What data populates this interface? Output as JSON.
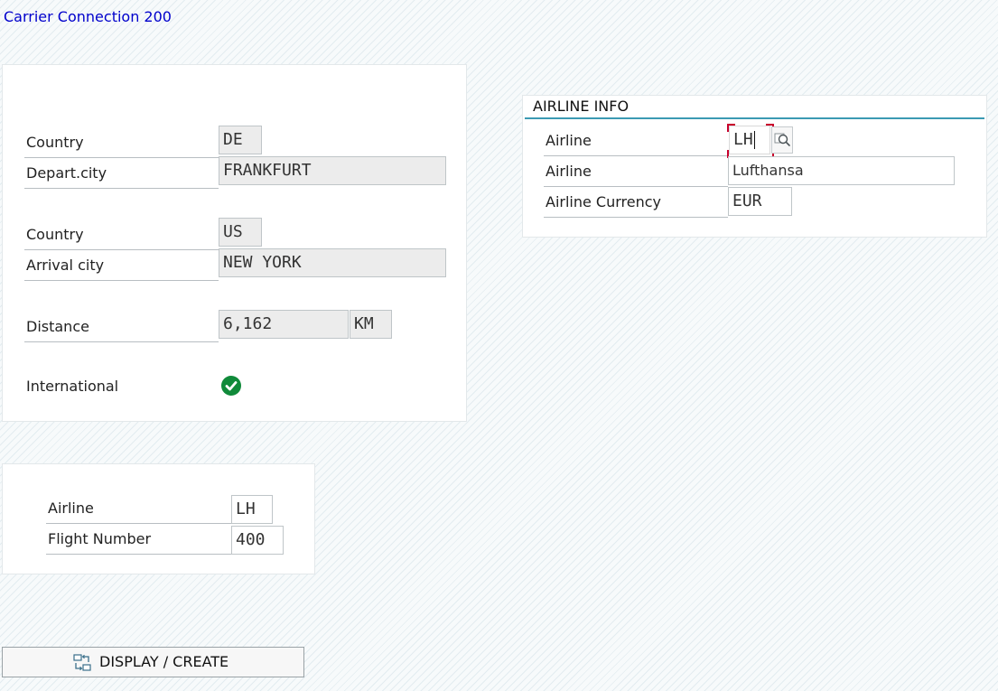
{
  "screen": {
    "title": "Carrier Connection 200"
  },
  "connection": {
    "from_country_label": "Country",
    "from_country": "DE",
    "depart_city_label": "Depart.city",
    "depart_city": "FRANKFURT",
    "to_country_label": "Country",
    "to_country": "US",
    "arrival_city_label": "Arrival city",
    "arrival_city": "NEW YORK",
    "distance_label": "Distance",
    "distance": "6,162",
    "distance_unit": "KM",
    "international_label": "International"
  },
  "airline_info": {
    "header": "AIRLINE INFO",
    "airline_code_label": "Airline",
    "airline_code": "LH",
    "airline_name_label": "Airline",
    "airline_name": "Lufthansa",
    "currency_label": "Airline Currency",
    "currency": "EUR"
  },
  "flight_key": {
    "airline_label": "Airline",
    "airline": "LH",
    "flight_number_label": "Flight Number",
    "flight_number": "400"
  },
  "actions": {
    "display_create_label": "DISPLAY / CREATE"
  },
  "icons": {
    "international": "checkmark-circle-icon",
    "value_help": "value-help-icon",
    "display_create": "display-create-icon"
  }
}
